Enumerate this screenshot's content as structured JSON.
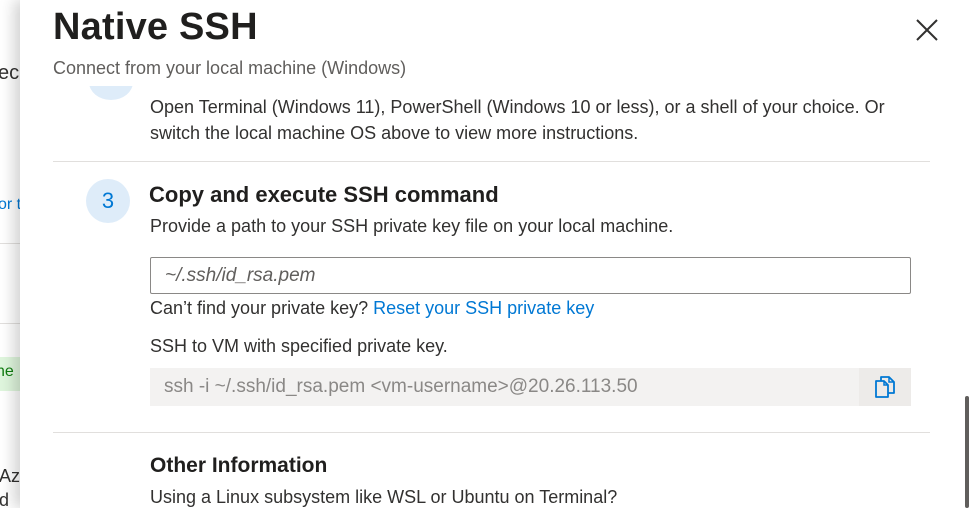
{
  "background": {
    "fragment_top": "ec",
    "fragment_link": "or t",
    "fragment_green": "ne",
    "fragment_az": "Az",
    "fragment_d": "d"
  },
  "panel": {
    "title": "Native SSH",
    "subtitle": "Connect from your local machine (Windows)",
    "intro_text": "Open Terminal (Windows 11), PowerShell (Windows 10 or less), or a shell of your choice. Or switch the local machine OS above to view more instructions.",
    "close_icon": "close-icon"
  },
  "step3": {
    "number": "3",
    "title": "Copy and execute SSH command",
    "description": "Provide a path to your SSH private key file on your local machine.",
    "key_input": {
      "value": "",
      "placeholder": "~/.ssh/id_rsa.pem"
    },
    "help_prefix": "Can’t find your private key? ",
    "help_link": "Reset your SSH private key",
    "command_label": "SSH to VM with specified private key.",
    "command": "ssh -i ~/.ssh/id_rsa.pem <vm-username>@20.26.113.50",
    "copy_icon": "copy-icon"
  },
  "other": {
    "title": "Other Information",
    "description": "Using a Linux subsystem like WSL or Ubuntu on Terminal?"
  },
  "colors": {
    "accent": "#0078d4",
    "step_circle_bg": "#deecf9",
    "divider": "#e1dfdd",
    "command_bg": "#f3f2f1"
  }
}
